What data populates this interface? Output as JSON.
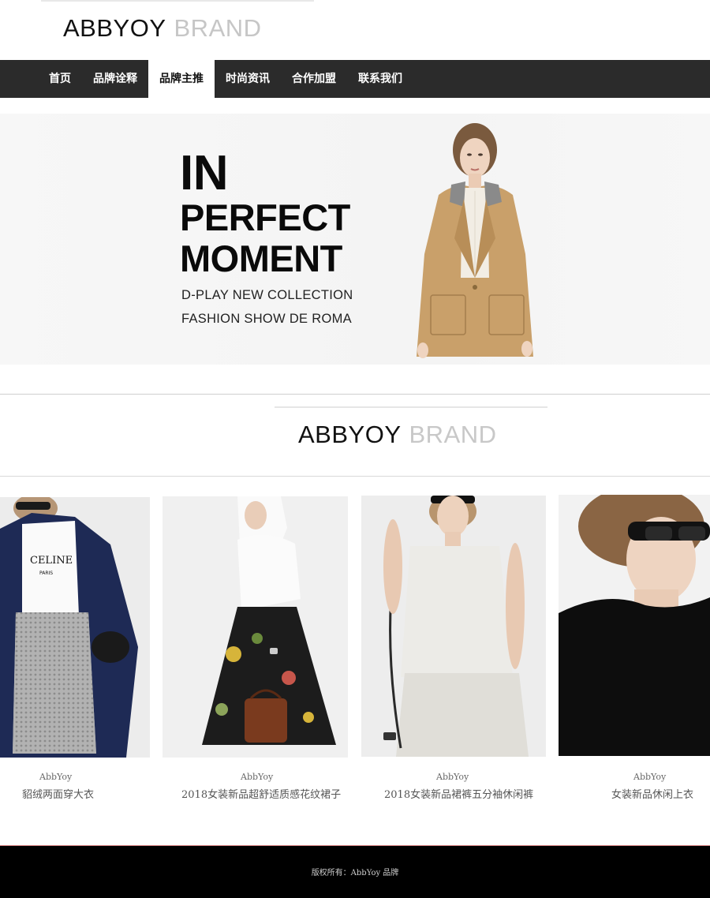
{
  "header": {
    "logo_primary": "ABBYOY",
    "logo_secondary": "BRAND"
  },
  "nav": {
    "items": [
      {
        "label": "首页",
        "active": false
      },
      {
        "label": "品牌诠释",
        "active": false
      },
      {
        "label": "品牌主推",
        "active": true
      },
      {
        "label": "时尚资讯",
        "active": false
      },
      {
        "label": "合作加盟",
        "active": false
      },
      {
        "label": "联系我们",
        "active": false
      }
    ]
  },
  "hero": {
    "line1": "IN",
    "line2": "PERFECT",
    "line3": "MOMENT",
    "sub1": "D-PLAY NEW COLLECTION",
    "sub2": "FASHION SHOW DE ROMA"
  },
  "section": {
    "brand_primary": "ABBYOY",
    "brand_secondary": "BRAND"
  },
  "products": [
    {
      "brand": "AbbYoy",
      "title": "貂绒两面穿大衣"
    },
    {
      "brand": "AbbYoy",
      "title": "2018女装新品超舒适质感花纹裙子"
    },
    {
      "brand": "AbbYoy",
      "title": "2018女装新品裙裤五分袖休闲裤"
    },
    {
      "brand": "AbbYoy",
      "title": "女装新品休闲上衣"
    }
  ],
  "footer": {
    "copyright": "版权所有：AbbYoy 品牌"
  },
  "colors": {
    "nav_bg": "#2b2b2b",
    "footer_bg": "#000000",
    "brand_gray": "#c6c6c6"
  }
}
